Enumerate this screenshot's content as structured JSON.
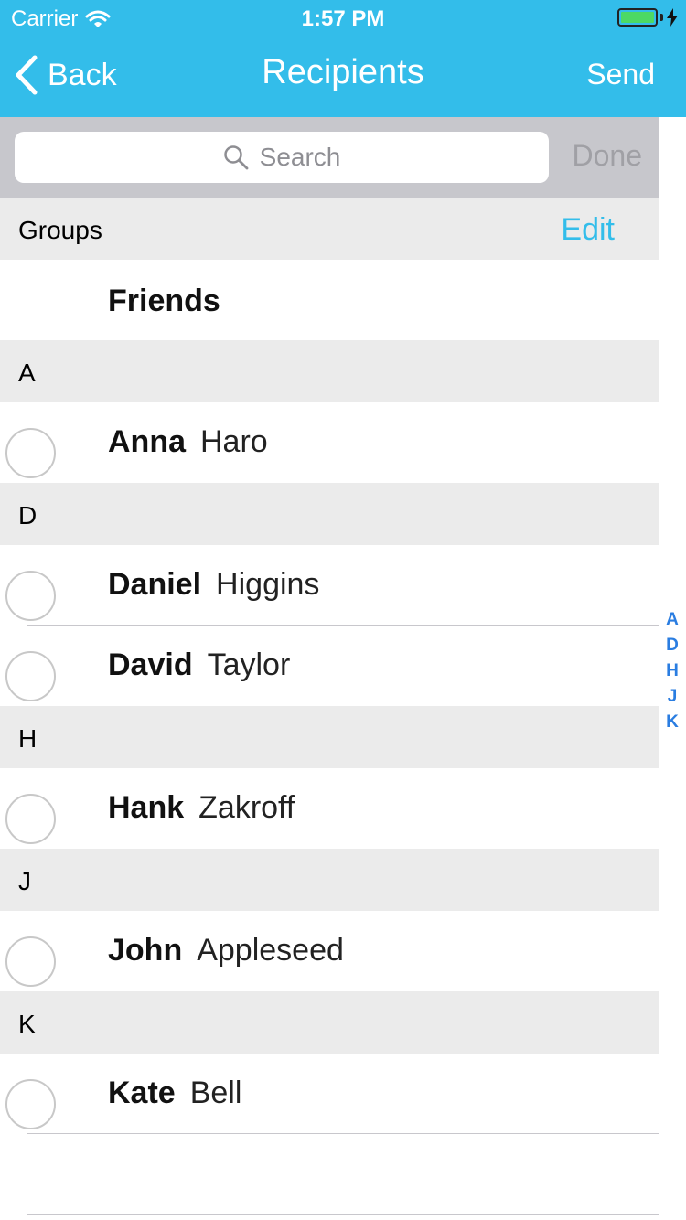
{
  "status_bar": {
    "carrier": "Carrier",
    "time": "1:57 PM",
    "battery_color": "#4cd964"
  },
  "nav": {
    "back_label": "Back",
    "title": "Recipients",
    "send_label": "Send",
    "bar_color": "#33bdea"
  },
  "search": {
    "placeholder": "Search",
    "done_label": "Done"
  },
  "groups_section": {
    "label": "Groups",
    "edit_label": "Edit",
    "items": [
      {
        "name": "Friends"
      }
    ]
  },
  "sections": [
    {
      "letter": "A",
      "contacts": [
        {
          "first": "Anna",
          "last": "Haro"
        }
      ]
    },
    {
      "letter": "D",
      "contacts": [
        {
          "first": "Daniel",
          "last": "Higgins"
        },
        {
          "first": "David",
          "last": "Taylor"
        }
      ]
    },
    {
      "letter": "H",
      "contacts": [
        {
          "first": "Hank",
          "last": "Zakroff"
        }
      ]
    },
    {
      "letter": "J",
      "contacts": [
        {
          "first": "John",
          "last": "Appleseed"
        }
      ]
    },
    {
      "letter": "K",
      "contacts": [
        {
          "first": "Kate",
          "last": "Bell"
        }
      ]
    }
  ],
  "index_letters": [
    "A",
    "D",
    "H",
    "J",
    "K"
  ],
  "icons": {
    "back": "chevron-left-icon",
    "search": "search-icon",
    "wifi": "wifi-icon",
    "battery": "battery-icon",
    "charging": "bolt-icon"
  }
}
